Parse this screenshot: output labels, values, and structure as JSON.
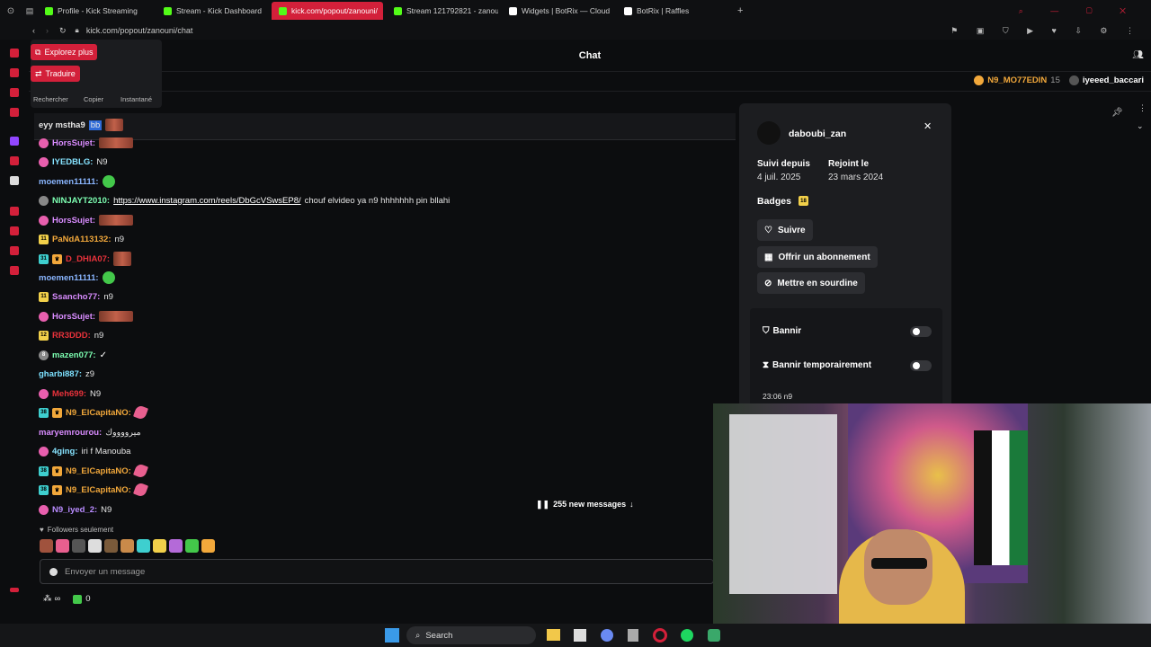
{
  "tabs": [
    {
      "label": "Profile - Kick Streaming",
      "active": false,
      "favicon_color": "#53fc18"
    },
    {
      "label": "Stream - Kick Dashboard",
      "active": false,
      "favicon_color": "#53fc18"
    },
    {
      "label": "kick.com/popout/zanouni/",
      "active": true,
      "favicon_color": "#53fc18"
    },
    {
      "label": "Stream 121792821 - zanou",
      "active": false,
      "favicon_color": "#53fc18"
    },
    {
      "label": "Widgets | BotRix — Cloud",
      "active": false,
      "favicon_color": "#ffffff"
    },
    {
      "label": "BotRix | Raffles",
      "active": false,
      "favicon_color": "#ffffff"
    }
  ],
  "address": {
    "url": "kick.com/popout/zanouni/chat"
  },
  "chat": {
    "title": "Chat"
  },
  "context_menu": {
    "explore": "Explorez plus",
    "translate": "Traduire",
    "search": "Rechercher",
    "copy": "Copier",
    "instant": "Instantané"
  },
  "top_gifters": [
    {
      "name": "N9_MO77EDIN",
      "count": "15"
    },
    {
      "name": "iyeeed_baccari",
      "count": ""
    }
  ],
  "pinned": {
    "user": "eyy mstha9",
    "highlight": "bb"
  },
  "messages": [
    {
      "user": "HorsSujet:",
      "color": "#d98cff",
      "badge": "pink",
      "text": "",
      "emote": "wide"
    },
    {
      "user": "IYEDBLG:",
      "color": "#86e3ff",
      "badge": "pink",
      "text": "N9",
      "emote": ""
    },
    {
      "user": "moemen11111:",
      "color": "#8ab6ff",
      "badge": "",
      "text": "",
      "emote": "blob"
    },
    {
      "user": "NINJAYT2010:",
      "color": "#7dffb2",
      "badge": "gray",
      "text": "chouf elvideo ya n9 hhhhhhh pin bllahi",
      "link": "https://www.instagram.com/reels/DbGcVSwsEP8/"
    },
    {
      "user": "HorsSujet:",
      "color": "#d98cff",
      "badge": "pink",
      "text": "",
      "emote": "wide"
    },
    {
      "user": "PaNdA113132:",
      "color": "#f2a83b",
      "badge": "yellow11",
      "text": "n9",
      "emote": ""
    },
    {
      "user": "D_DHIA07:",
      "color": "#e8323b",
      "badge": "cyan31",
      "text": "",
      "emote": "face"
    },
    {
      "user": "moemen11111:",
      "color": "#8ab6ff",
      "badge": "",
      "text": "",
      "emote": "blob"
    },
    {
      "user": "Ssancho77:",
      "color": "#d98cff",
      "badge": "yellow11",
      "text": "n9",
      "emote": ""
    },
    {
      "user": "HorsSujet:",
      "color": "#d98cff",
      "badge": "pink",
      "text": "",
      "emote": "wide"
    },
    {
      "user": "RR3DDD:",
      "color": "#e8323b",
      "badge": "yellow12",
      "text": "n9",
      "emote": ""
    },
    {
      "user": "mazen077:",
      "color": "#7dffb2",
      "badge": "gray8",
      "text": "",
      "emote": "swoosh"
    },
    {
      "user": "gharbi887:",
      "color": "#7de1ff",
      "badge": "",
      "text": "z9",
      "emote": ""
    },
    {
      "user": "Meh699:",
      "color": "#e8323b",
      "badge": "pink",
      "text": "N9",
      "emote": ""
    },
    {
      "user": "N9_ElCapitaNO:",
      "color": "#f2a83b",
      "badge": "cyan38",
      "text": "",
      "emote": "leaf"
    },
    {
      "user": "maryemrourou:",
      "color": "#d98cff",
      "badge": "",
      "text": "ميرووووك",
      "emote": ""
    },
    {
      "user": "4ging:",
      "color": "#86e3ff",
      "badge": "pink",
      "text": "iri f Manouba",
      "emote": ""
    },
    {
      "user": "N9_ElCapitaNO:",
      "color": "#f2a83b",
      "badge": "cyan38",
      "text": "",
      "emote": "leaf"
    },
    {
      "user": "N9_ElCapitaNO:",
      "color": "#f2a83b",
      "badge": "cyan38",
      "text": "",
      "emote": "leaf"
    },
    {
      "user": "N9_iyed_2:",
      "color": "#b98cff",
      "badge": "pink",
      "text": "N9",
      "emote": ""
    }
  ],
  "new_messages": "255 new messages",
  "followers_only": "Followers seulement",
  "input": {
    "placeholder": "Envoyer un message"
  },
  "bottom": {
    "points": "∞",
    "count": "0"
  },
  "user_card": {
    "username": "daboubi_zan",
    "followed_label": "Suivi depuis",
    "followed_date": "4 juil. 2025",
    "joined_label": "Rejoint le",
    "joined_date": "23 mars 2024",
    "badges_label": "Badges",
    "badge_number": "18",
    "follow_btn": "Suivre",
    "gift_btn": "Offrir un abonnement",
    "mute_btn": "Mettre en sourdine",
    "ban_label": "Bannir",
    "timeout_label": "Bannir temporairement",
    "last_message_time": "23:06 n9"
  },
  "taskbar": {
    "search": "Search"
  }
}
